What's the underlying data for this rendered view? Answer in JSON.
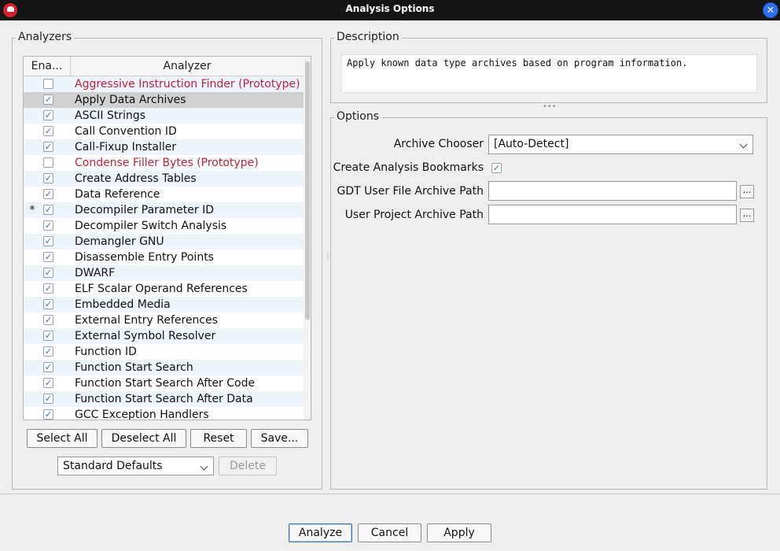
{
  "window": {
    "title": "Analysis Options",
    "close_glyph": "✕"
  },
  "analyzers": {
    "legend": "Analyzers",
    "columns": {
      "enabled": "Ena...",
      "analyzer": "Analyzer"
    },
    "rows": [
      {
        "name": "Aggressive Instruction Finder (Prototype)",
        "enabled": false,
        "prototype": true,
        "mark": ""
      },
      {
        "name": "Apply Data Archives",
        "enabled": true,
        "prototype": false,
        "mark": "",
        "selected": true
      },
      {
        "name": "ASCII Strings",
        "enabled": true,
        "prototype": false,
        "mark": ""
      },
      {
        "name": "Call Convention ID",
        "enabled": true,
        "prototype": false,
        "mark": ""
      },
      {
        "name": "Call-Fixup Installer",
        "enabled": true,
        "prototype": false,
        "mark": ""
      },
      {
        "name": "Condense Filler Bytes (Prototype)",
        "enabled": false,
        "prototype": true,
        "mark": ""
      },
      {
        "name": "Create Address Tables",
        "enabled": true,
        "prototype": false,
        "mark": ""
      },
      {
        "name": "Data Reference",
        "enabled": true,
        "prototype": false,
        "mark": ""
      },
      {
        "name": "Decompiler Parameter ID",
        "enabled": true,
        "prototype": false,
        "mark": "*"
      },
      {
        "name": "Decompiler Switch Analysis",
        "enabled": true,
        "prototype": false,
        "mark": ""
      },
      {
        "name": "Demangler GNU",
        "enabled": true,
        "prototype": false,
        "mark": ""
      },
      {
        "name": "Disassemble Entry Points",
        "enabled": true,
        "prototype": false,
        "mark": ""
      },
      {
        "name": "DWARF",
        "enabled": true,
        "prototype": false,
        "mark": ""
      },
      {
        "name": "ELF Scalar Operand References",
        "enabled": true,
        "prototype": false,
        "mark": ""
      },
      {
        "name": "Embedded Media",
        "enabled": true,
        "prototype": false,
        "mark": ""
      },
      {
        "name": "External Entry References",
        "enabled": true,
        "prototype": false,
        "mark": ""
      },
      {
        "name": "External Symbol Resolver",
        "enabled": true,
        "prototype": false,
        "mark": ""
      },
      {
        "name": "Function ID",
        "enabled": true,
        "prototype": false,
        "mark": ""
      },
      {
        "name": "Function Start Search",
        "enabled": true,
        "prototype": false,
        "mark": ""
      },
      {
        "name": "Function Start Search After Code",
        "enabled": true,
        "prototype": false,
        "mark": ""
      },
      {
        "name": "Function Start Search After Data",
        "enabled": true,
        "prototype": false,
        "mark": ""
      },
      {
        "name": "GCC Exception Handlers",
        "enabled": true,
        "prototype": false,
        "mark": ""
      }
    ],
    "buttons": {
      "select_all": "Select All",
      "deselect_all": "Deselect All",
      "reset": "Reset",
      "save": "Save..."
    },
    "profile": {
      "selected": "Standard Defaults",
      "delete_label": "Delete"
    }
  },
  "description": {
    "legend": "Description",
    "text": "Apply known data type archives based on program information."
  },
  "options": {
    "legend": "Options",
    "archive_chooser_label": "Archive Chooser",
    "archive_chooser_value": "[Auto-Detect]",
    "create_bookmarks_label": "Create Analysis Bookmarks",
    "create_bookmarks_checked": true,
    "gdt_path_label": "GDT User File Archive Path",
    "gdt_path_value": "",
    "user_project_path_label": "User Project Archive Path",
    "user_project_path_value": "",
    "browse_glyph": "..."
  },
  "footer": {
    "analyze": "Analyze",
    "cancel": "Cancel",
    "apply": "Apply"
  },
  "colors": {
    "prototype_text": "#c41e3a",
    "selected_row": "#d0d0d0",
    "alt_row": "#eef4fb",
    "close_button": "#2f6ef0"
  },
  "icons": {
    "app": "ghidra-dragon-icon",
    "close": "close-icon",
    "check": "checkmark-icon",
    "dropdown": "chevron-down-icon"
  }
}
